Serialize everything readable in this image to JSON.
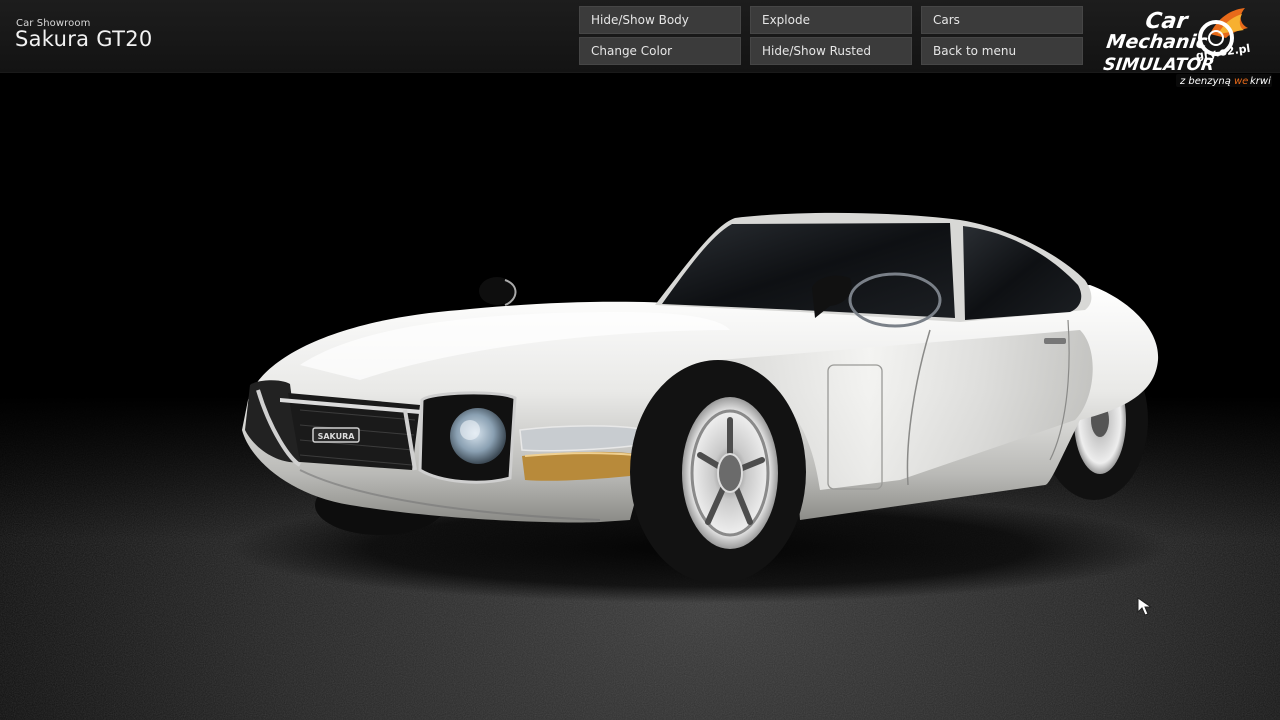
{
  "header": {
    "subtitle": "Car Showroom",
    "title": "Sakura GT20"
  },
  "menu": {
    "buttons": [
      {
        "label": "Hide/Show Body"
      },
      {
        "label": "Explode"
      },
      {
        "label": "Cars"
      },
      {
        "label": "Change Color"
      },
      {
        "label": "Hide/Show Rusted"
      },
      {
        "label": "Back to menu"
      }
    ]
  },
  "logo": {
    "line1": "Car Mechanic",
    "line2": "SIMULATOR",
    "tagline": "z benzyną we krwi",
    "domain": "gry.o2.pl"
  },
  "car": {
    "badge": "SAKURA",
    "body_color": "#e8e8e6"
  },
  "colors": {
    "topbar": "#171717",
    "button": "#3b3b3b",
    "background": "#000000"
  }
}
